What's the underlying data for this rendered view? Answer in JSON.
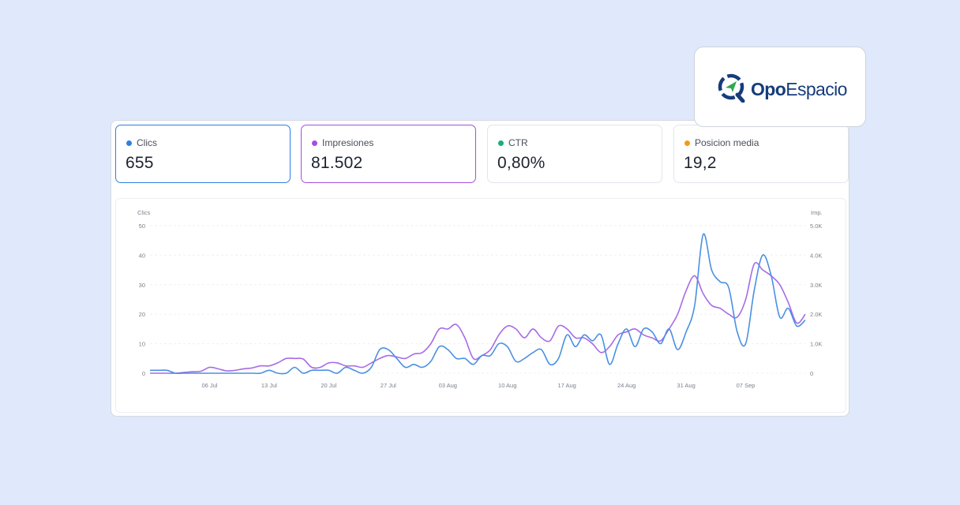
{
  "brand": {
    "name_bold": "Opo",
    "name_light": "Espacio",
    "color": "#163c7a",
    "accent": "#2fa84f",
    "icon": "location-search-icon"
  },
  "metrics": [
    {
      "label": "Clics",
      "value": "655",
      "color": "#2f7fe0",
      "active": true
    },
    {
      "label": "Impresiones",
      "value": "81.502",
      "color": "#a54ee0",
      "active": true
    },
    {
      "label": "CTR",
      "value": "0,80%",
      "color": "#16b07a",
      "active": false
    },
    {
      "label": "Posicion media",
      "value": "19,2",
      "color": "#f49a12",
      "active": false
    }
  ],
  "chart_data": {
    "type": "line",
    "x_tick_labels": [
      "06 Jul",
      "13 Jul",
      "20 Jul",
      "27 Jul",
      "03 Aug",
      "10 Aug",
      "17 Aug",
      "24 Aug",
      "31 Aug",
      "07 Sep"
    ],
    "y_left": {
      "label": "Clics",
      "ticks": [
        "0",
        "10",
        "20",
        "30",
        "40",
        "50"
      ],
      "range": [
        0,
        50
      ]
    },
    "y_right": {
      "label": "Imp.",
      "ticks": [
        "0",
        "1.0K",
        "2.0K",
        "3.0K",
        "4.0K",
        "5.0K"
      ],
      "range": [
        0,
        5000
      ]
    },
    "grid": true,
    "series": [
      {
        "name": "Clics",
        "color": "#4a90e2",
        "axis": "left",
        "values": [
          1,
          1,
          1,
          0,
          0,
          0,
          0,
          0,
          0,
          0,
          0,
          0,
          0,
          0,
          1,
          0,
          0,
          2,
          0,
          1,
          1,
          1,
          0,
          2,
          1,
          0,
          2,
          8,
          8,
          5,
          2,
          3,
          2,
          4,
          9,
          8,
          5,
          5,
          3,
          6,
          6,
          10,
          9,
          4,
          5,
          7,
          8,
          3,
          5,
          13,
          9,
          13,
          11,
          13,
          3,
          10,
          15,
          9,
          15,
          14,
          10,
          15,
          8,
          14,
          23,
          47,
          35,
          31,
          29,
          14,
          10,
          28,
          40,
          33,
          19,
          22,
          16,
          18
        ]
      },
      {
        "name": "Impresiones",
        "color": "#a86ae6",
        "axis": "right",
        "values": [
          0,
          0,
          0,
          0,
          30,
          50,
          70,
          200,
          150,
          80,
          100,
          150,
          180,
          250,
          250,
          350,
          500,
          500,
          480,
          200,
          200,
          350,
          350,
          250,
          250,
          200,
          350,
          500,
          600,
          550,
          500,
          650,
          700,
          1000,
          1500,
          1500,
          1650,
          1200,
          500,
          600,
          800,
          1300,
          1600,
          1500,
          1200,
          1500,
          1200,
          1100,
          1600,
          1500,
          1200,
          1200,
          1000,
          700,
          900,
          1300,
          1400,
          1500,
          1300,
          1200,
          1100,
          1500,
          2000,
          2800,
          3300,
          2700,
          2300,
          2200,
          2000,
          1900,
          2500,
          3700,
          3500,
          3300,
          3000,
          2400,
          1700,
          2000
        ]
      }
    ]
  }
}
